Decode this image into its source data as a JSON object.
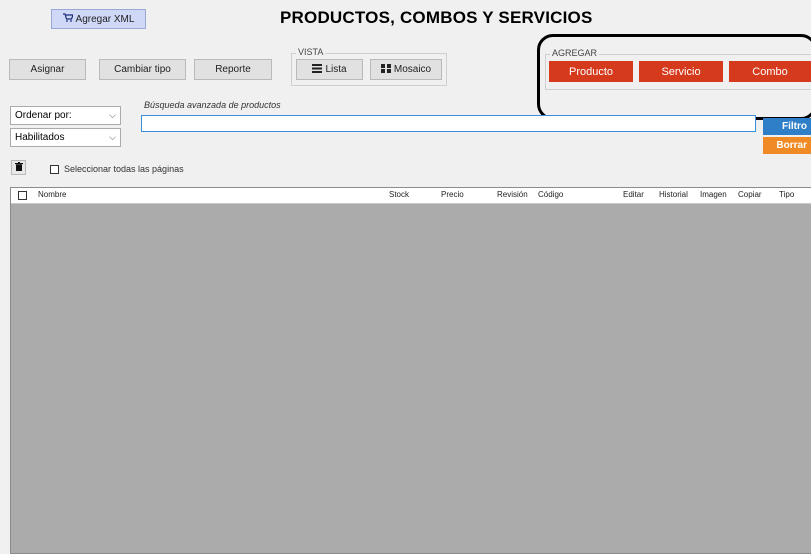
{
  "header": {
    "title": "PRODUCTOS, COMBOS Y SERVICIOS",
    "xml_button": "Agregar XML"
  },
  "toolbar": {
    "asignar": "Asignar",
    "cambiar_tipo": "Cambiar tipo",
    "reporte": "Reporte"
  },
  "vista": {
    "legend": "VISTA",
    "lista": "Lista",
    "mosaico": "Mosaico"
  },
  "agregar": {
    "legend": "AGREGAR",
    "producto": "Producto",
    "servicio": "Servicio",
    "combo": "Combo"
  },
  "filters": {
    "ordenar": "Ordenar por:",
    "habilitados": "Habilitados",
    "search_label": "Búsqueda avanzada de productos",
    "search_value": "",
    "filtro": "Filtro",
    "borrar": "Borrar",
    "select_all": "Seleccionar todas las páginas"
  },
  "table": {
    "columns": [
      "Nombre",
      "Stock",
      "Precio",
      "Revisión",
      "Código",
      "Editar",
      "Historial",
      "Imagen",
      "Copiar",
      "Tipo"
    ]
  },
  "colors": {
    "accent_red": "#d63a1c",
    "filtro_blue": "#2e7fc8",
    "borrar_orange": "#f08a24"
  }
}
